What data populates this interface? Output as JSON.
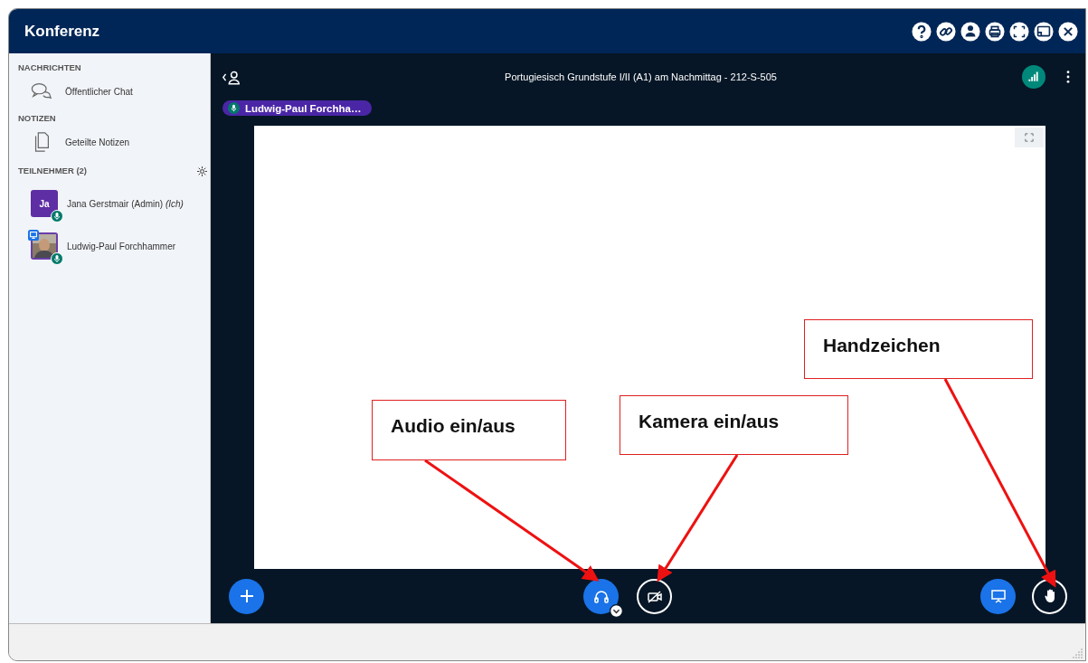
{
  "window": {
    "title": "Konferenz"
  },
  "sidebar": {
    "sections": [
      {
        "heading": "NACHRICHTEN",
        "items": [
          {
            "kind": "chat",
            "label": "Öffentlicher Chat"
          }
        ]
      },
      {
        "heading": "NOTIZEN",
        "items": [
          {
            "kind": "notes",
            "label": "Geteilte Notizen"
          }
        ]
      }
    ],
    "participants_heading": "TEILNEHMER (2)",
    "participants": [
      {
        "kind": "initials",
        "name": "Jana Gerstmair (Admin) *(Ich)*",
        "initials": "Ja",
        "presenter": false
      },
      {
        "kind": "picture",
        "name": "Ludwig-Paul Forchhammer",
        "presenter": true
      }
    ]
  },
  "meeting": {
    "title": "Portugiesisch Grundstufe I/II (A1) am Nachmittag - 212-S-505",
    "talking": "Ludwig-Paul Forchha…"
  },
  "actions": [
    {
      "kind": "audio",
      "active": true
    },
    {
      "kind": "camera",
      "active": false
    },
    {
      "kind": "present",
      "active": true
    },
    {
      "kind": "hand",
      "active": false
    }
  ],
  "annotations": [
    {
      "text": "Audio ein/aus"
    },
    {
      "text": "Kamera ein/aus"
    },
    {
      "text": "Handzeichen"
    }
  ]
}
